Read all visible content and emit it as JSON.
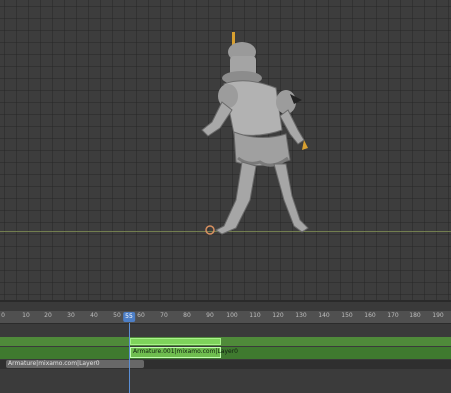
{
  "timeline": {
    "ticks": [
      "0",
      "10",
      "20",
      "30",
      "40",
      "50",
      "55",
      "60",
      "70",
      "80",
      "90",
      "100",
      "110",
      "120",
      "130",
      "140",
      "150",
      "160",
      "170",
      "180",
      "190"
    ],
    "current_frame": "55"
  },
  "nla": {
    "action_strip_label": "Armature.001|mixamo.com|Layer0",
    "track_label": "Armature|mixamo.com|Layer0"
  },
  "colors": {
    "strip_green": "#7ed35b",
    "playhead_blue": "#4d7fc7"
  }
}
